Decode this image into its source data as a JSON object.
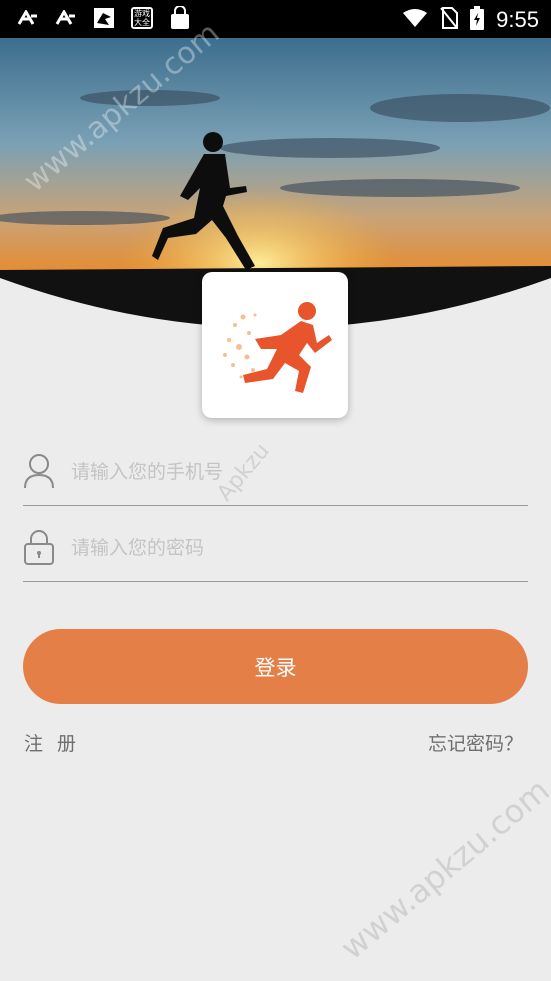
{
  "status_bar": {
    "time": "9:55",
    "game_icon_text": "游戏大全"
  },
  "login": {
    "phone_placeholder": "请输入您的手机号",
    "password_placeholder": "请输入您的密码",
    "submit_label": "登录",
    "register_label": "注 册",
    "forgot_label": "忘记密码？"
  },
  "watermarks": {
    "top": "www.apkzu.com",
    "middle": "Apkzu",
    "bottom": "www.apkzu.com"
  },
  "colors": {
    "accent": "#e57f48",
    "background": "#ececec"
  }
}
